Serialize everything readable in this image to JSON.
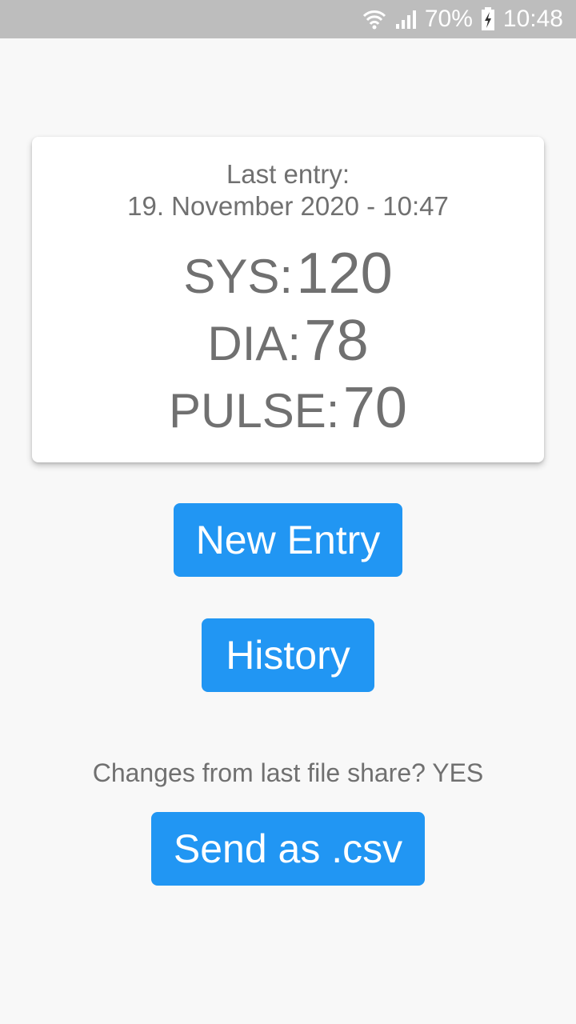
{
  "status_bar": {
    "battery_percent": "70%",
    "time": "10:48",
    "icons": [
      "wifi-icon",
      "signal-icon",
      "battery-charging-icon"
    ]
  },
  "last_entry": {
    "label": "Last entry:",
    "datetime": "19. November 2020 - 10:47",
    "sys_label": "SYS:",
    "sys_value": "120",
    "dia_label": "DIA:",
    "dia_value": "78",
    "pulse_label": "PULSE:",
    "pulse_value": "70"
  },
  "buttons": {
    "new_entry": "New Entry",
    "history": "History",
    "send_csv": "Send as .csv"
  },
  "share_status": "Changes from last file share? YES",
  "colors": {
    "accent": "#2196f3",
    "text_gray": "#707070",
    "status_bar": "#bdbdbd",
    "background": "#f8f8f8"
  }
}
